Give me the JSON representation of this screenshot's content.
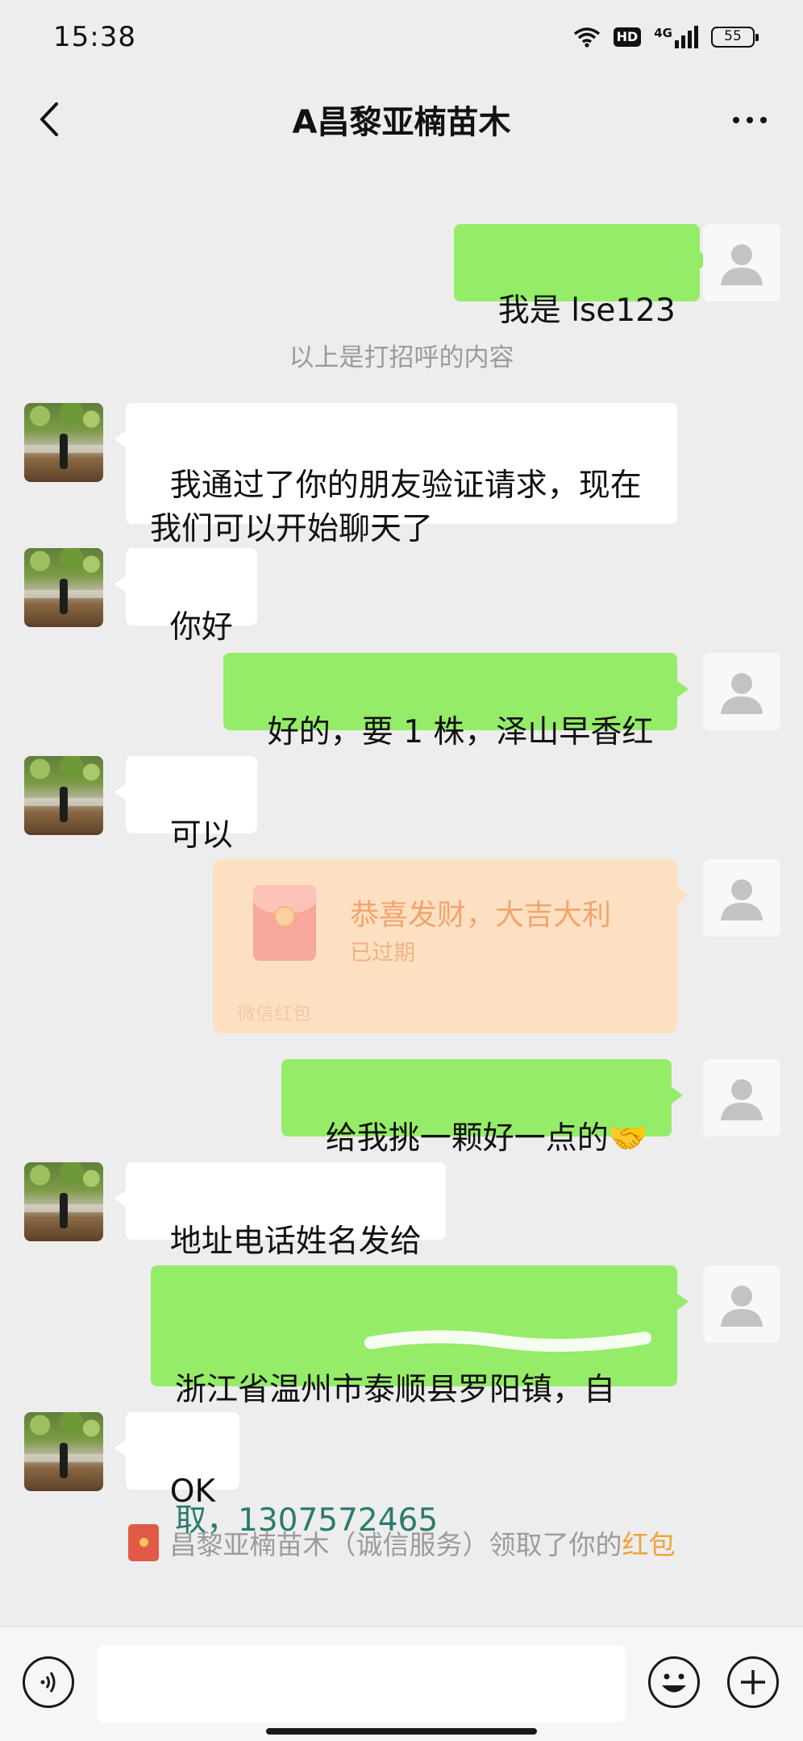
{
  "status_bar": {
    "time": "15:38",
    "hd": "HD",
    "network": "4G",
    "battery": "55",
    "icons": [
      "wifi-icon",
      "hd-icon",
      "signal-icon",
      "battery-icon"
    ]
  },
  "nav": {
    "title": "A昌黎亚楠苗木",
    "icons": [
      "back-arrow-icon",
      "more-icon"
    ]
  },
  "messages": [
    {
      "from": "me",
      "text": "我是 lse123"
    },
    {
      "type": "system",
      "text": "以上是打招呼的内容"
    },
    {
      "from": "peer",
      "text": "我通过了你的朋友验证请求，现在我们可以开始聊天了"
    },
    {
      "from": "peer",
      "text": "你好"
    },
    {
      "from": "me",
      "text": "好的，要 1 株，泽山早香红"
    },
    {
      "from": "peer",
      "text": "可以"
    },
    {
      "from": "me",
      "type": "red_packet",
      "title": "恭喜发财，大吉大利",
      "status": "已过期",
      "footer": "微信红包"
    },
    {
      "from": "me",
      "text": "给我挑一颗好一点的🤝"
    },
    {
      "from": "peer",
      "text": "地址电话姓名发给"
    },
    {
      "from": "me",
      "text_line1": "浙江省温州市泰顺县罗阳镇，自",
      "text_line2": "取，1307572465"
    },
    {
      "from": "peer",
      "text": "OK"
    }
  ],
  "received_note": {
    "prefix": "昌黎亚楠苗木（诚信服务）领取了你的",
    "link": "红包"
  },
  "input_bar": {
    "icons": [
      "voice-icon",
      "emoji-icon",
      "plus-icon"
    ]
  },
  "colors": {
    "background": "#ededed",
    "my_bubble": "#95ec69",
    "peer_bubble": "#ffffff",
    "red_packet_expired": "#fde0c1",
    "link": "#f0a33a"
  }
}
